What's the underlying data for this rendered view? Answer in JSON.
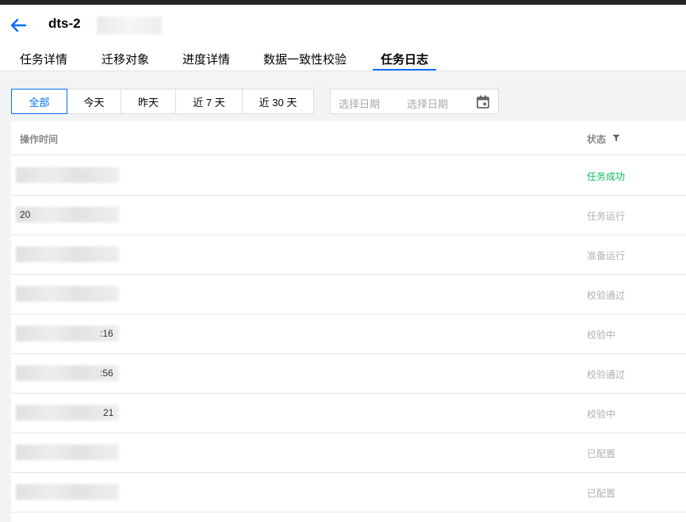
{
  "header": {
    "title": "dts-2",
    "tabs": [
      {
        "label": "任务详情"
      },
      {
        "label": "迁移对象"
      },
      {
        "label": "进度详情"
      },
      {
        "label": "数据一致性校验"
      },
      {
        "label": "任务日志"
      }
    ],
    "active_tab": "任务日志"
  },
  "filter": {
    "ranges": [
      {
        "label": "全部"
      },
      {
        "label": "今天"
      },
      {
        "label": "昨天"
      },
      {
        "label": "近 7 天"
      },
      {
        "label": "近 30 天"
      }
    ],
    "active_range": "全部",
    "date_start_placeholder": "选择日期",
    "date_end_placeholder": "选择日期"
  },
  "table": {
    "columns": {
      "time": "操作时间",
      "status": "状态"
    },
    "rows": [
      {
        "time_fragment": "",
        "status": "任务成功"
      },
      {
        "time_fragment": "20",
        "status": "任务运行"
      },
      {
        "time_fragment": "",
        "status": "准备运行"
      },
      {
        "time_fragment": "",
        "status": "校验通过"
      },
      {
        "time_fragment": ":16",
        "status": "校验中"
      },
      {
        "time_fragment": ":56",
        "status": "校验通过"
      },
      {
        "time_fragment": "21",
        "status": "校验中"
      },
      {
        "time_fragment": "",
        "status": "已配置"
      },
      {
        "time_fragment": "",
        "status": "已配置"
      }
    ]
  },
  "colors": {
    "accent": "#006eff",
    "success": "#0abf5b",
    "muted": "#b0b0b0"
  }
}
